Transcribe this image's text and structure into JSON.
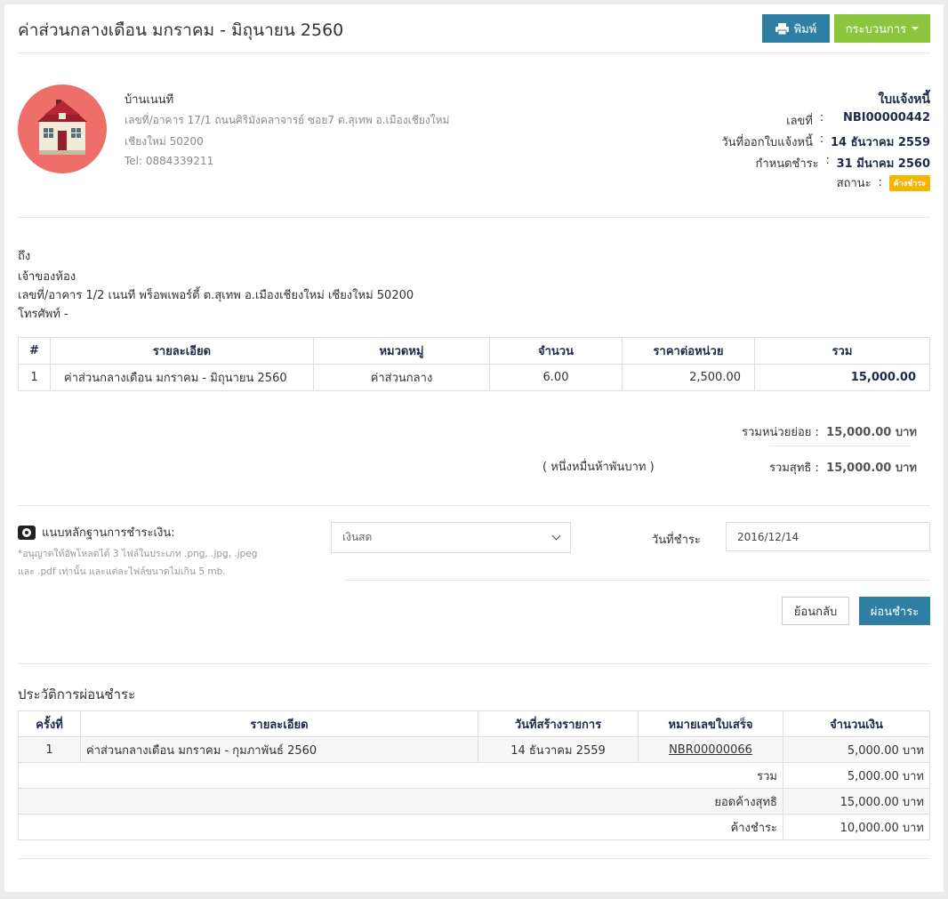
{
  "header": {
    "title": "ค่าส่วนกลางเดือน มกราคม - มิถุนายน 2560",
    "print_label": "พิมพ์",
    "process_label": "กระบวนการ"
  },
  "company": {
    "name": "บ้านเนนที",
    "address": "เลขที่/อาคาร 17/1 ถนนศิริมังคลาจารย์ ซอย7 ต.สุเทพ อ.เมืองเชียงใหม่",
    "city": "เชียงใหม่ 50200",
    "tel": "Tel: 0884339211"
  },
  "invoice": {
    "heading": "ใบแจ้งหนี้",
    "number_label": "เลขที่",
    "number": "NBI00000442",
    "issue_label": "วันที่ออกใบแจ้งหนี้",
    "issue_date": "14 ธันวาคม 2559",
    "due_label": "กำหนดชำระ",
    "due_date": "31 มีนาคม 2560",
    "status_label": "สถานะ",
    "status": "ค้างชำระ",
    "colon": ":"
  },
  "recipient": {
    "to": "ถึง",
    "name": "เจ้าของห้อง",
    "address": "เลขที่/อาคาร 1/2 เนนที พร็อพเพอร์ตี้ ต.สุเทพ อ.เมืองเชียงใหม่ เชียงใหม่ 50200",
    "phone": "โทรศัพท์ -"
  },
  "items": {
    "headers": [
      "#",
      "รายละเอียด",
      "หมวดหมู่",
      "จำนวน",
      "ราคาต่อหน่วย",
      "รวม"
    ],
    "rows": [
      [
        "1",
        "ค่าส่วนกลางเดือน มกราคม - มิถุนายน 2560",
        "ค่าส่วนกลาง",
        "6.00",
        "2,500.00",
        "15,000.00"
      ]
    ]
  },
  "summary": {
    "subtotal_label": "รวมหน่วยย่อย :",
    "subtotal": "15,000.00 บาท",
    "words": "( หนึ่งหมื่นห้าพันบาท )",
    "net_label": "รวมสุทธิ :",
    "net": "15,000.00 บาท"
  },
  "payment": {
    "attach_label": "แนบหลักฐานการชำระเงิน:",
    "note_line1": "*อนุญาตให้อัพโหลดได้ 3 ไฟล์ในประเภท .png, .jpg, .jpeg",
    "note_line2": "และ .pdf เท่านั้น และแต่ละไฟล์ขนาดไม่เกิน 5 mb.",
    "method": "เงินสด",
    "date_label": "วันที่ชำระ",
    "date": "2016/12/14",
    "back_label": "ย้อนกลับ",
    "pay_label": "ผ่อนชำระ"
  },
  "history": {
    "title": "ประวัติการผ่อนชำระ",
    "headers": [
      "ครั้งที่",
      "รายละเอียด",
      "วันที่สร้างรายการ",
      "หมายเลขใบเสร็จ",
      "จำนวนเงิน"
    ],
    "rows": [
      [
        "1",
        "ค่าส่วนกลางเดือน มกราคม - กุมภาพันธ์ 2560",
        "14 ธันวาคม 2559",
        "NBR00000066",
        "5,000.00 บาท"
      ]
    ],
    "total_label": "รวม",
    "total": "5,000.00 บาท",
    "net_label": "ยอดค้างสุทธิ",
    "net": "15,000.00 บาท",
    "outstanding_label": "ค้างชำระ",
    "outstanding": "10,000.00 บาท"
  },
  "colors": {
    "primary": "#2e7fa3",
    "success": "#8cc63f",
    "warning": "#f5b400",
    "logo_bg": "#ee6e6a"
  }
}
